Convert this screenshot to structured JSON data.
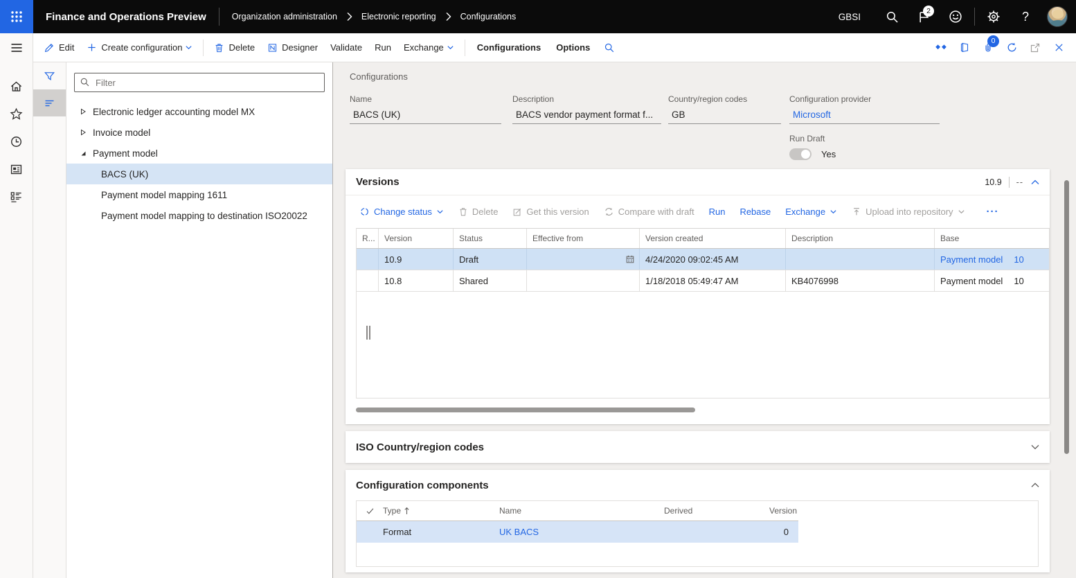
{
  "topbar": {
    "app_title": "Finance and Operations Preview",
    "breadcrumb": [
      "Organization administration",
      "Electronic reporting",
      "Configurations"
    ],
    "company": "GBSI",
    "notification_count": "2",
    "help_glyph": "?"
  },
  "action_pane": {
    "edit": "Edit",
    "create_configuration": "Create configuration",
    "delete": "Delete",
    "designer": "Designer",
    "validate": "Validate",
    "run": "Run",
    "exchange": "Exchange",
    "configurations": "Configurations",
    "options": "Options",
    "attachments_count": "0"
  },
  "tree_panel": {
    "filter_placeholder": "Filter",
    "items": [
      {
        "label": "Electronic ledger accounting model MX"
      },
      {
        "label": "Invoice model"
      },
      {
        "label": "Payment model"
      },
      {
        "label": "BACS (UK)"
      },
      {
        "label": "Payment model mapping 1611"
      },
      {
        "label": "Payment model mapping to destination ISO20022"
      }
    ]
  },
  "header": {
    "title": "Configurations",
    "name_label": "Name",
    "name_value": "BACS (UK)",
    "description_label": "Description",
    "description_value": "BACS vendor payment format f...",
    "country_label": "Country/region codes",
    "country_value": "GB",
    "provider_label": "Configuration provider",
    "provider_value": "Microsoft",
    "run_draft_label": "Run Draft",
    "run_draft_value": "Yes"
  },
  "versions": {
    "title": "Versions",
    "badge": "10.9",
    "dash": "--",
    "toolbar": {
      "change_status": "Change status",
      "delete": "Delete",
      "get_this_version": "Get this version",
      "compare_with_draft": "Compare with draft",
      "run": "Run",
      "rebase": "Rebase",
      "exchange": "Exchange",
      "upload": "Upload into repository",
      "more_glyph": "···"
    },
    "columns": [
      "R...",
      "Version",
      "Status",
      "Effective from",
      "Version created",
      "Description",
      "Base"
    ],
    "rows": [
      {
        "version": "10.9",
        "status": "Draft",
        "effective_from": "",
        "created": "4/24/2020 09:02:45 AM",
        "description": "",
        "base": "Payment model",
        "base_version": "10"
      },
      {
        "version": "10.8",
        "status": "Shared",
        "effective_from": "",
        "created": "1/18/2018 05:49:47 AM",
        "description": "KB4076998",
        "base": "Payment model",
        "base_version": "10"
      }
    ]
  },
  "iso_section": {
    "title": "ISO Country/region codes"
  },
  "components": {
    "title": "Configuration components",
    "columns": {
      "type": "Type",
      "name": "Name",
      "derived": "Derived",
      "version": "Version"
    },
    "rows": [
      {
        "type": "Format",
        "name": "UK BACS",
        "derived": "",
        "version": "0"
      }
    ]
  }
}
